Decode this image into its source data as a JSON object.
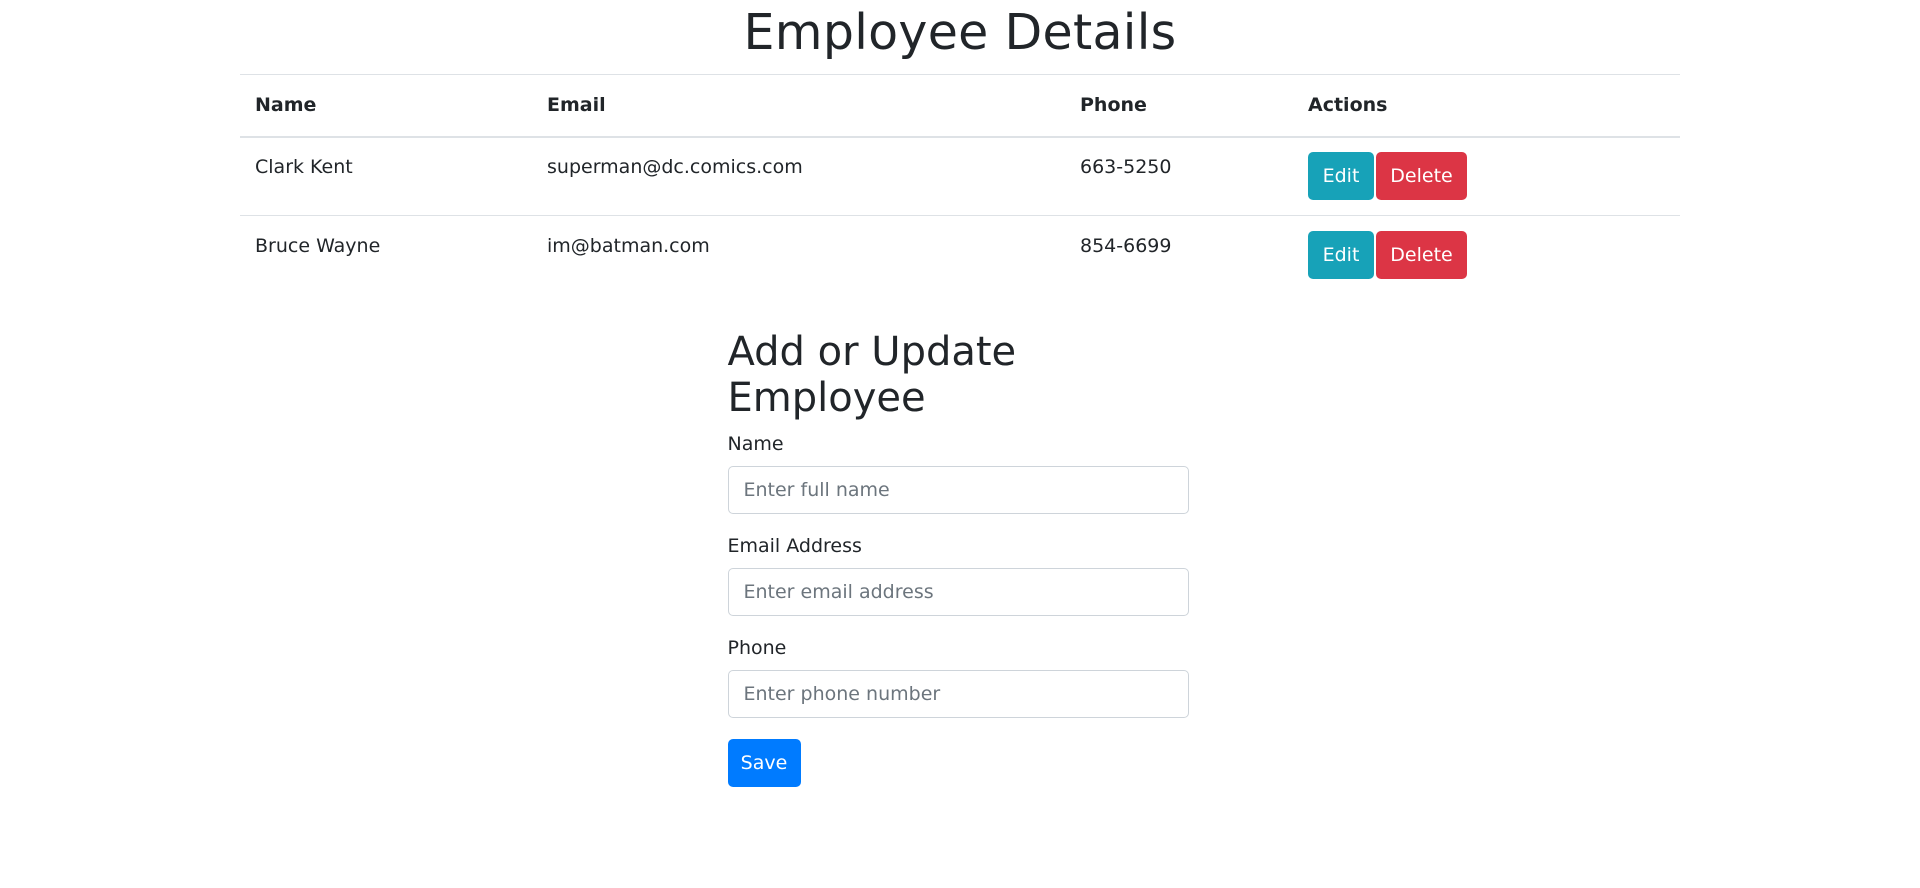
{
  "page": {
    "title": "Employee Details"
  },
  "table": {
    "headers": {
      "name": "Name",
      "email": "Email",
      "phone": "Phone",
      "actions": "Actions"
    },
    "rows": [
      {
        "name": "Clark Kent",
        "email": "superman@dc.comics.com",
        "phone": "663-5250",
        "edit_label": "Edit",
        "delete_label": "Delete"
      },
      {
        "name": "Bruce Wayne",
        "email": "im@batman.com",
        "phone": "854-6699",
        "edit_label": "Edit",
        "delete_label": "Delete"
      }
    ]
  },
  "form": {
    "title": "Add or Update Employee",
    "name": {
      "label": "Name",
      "placeholder": "Enter full name",
      "value": ""
    },
    "email": {
      "label": "Email Address",
      "placeholder": "Enter email address",
      "value": ""
    },
    "phone": {
      "label": "Phone",
      "placeholder": "Enter phone number",
      "value": ""
    },
    "save_label": "Save"
  },
  "colors": {
    "edit_button": "#17a2b8",
    "delete_button": "#dc3545",
    "save_button": "#007bff",
    "text": "#212529",
    "border": "#dee2e6"
  }
}
